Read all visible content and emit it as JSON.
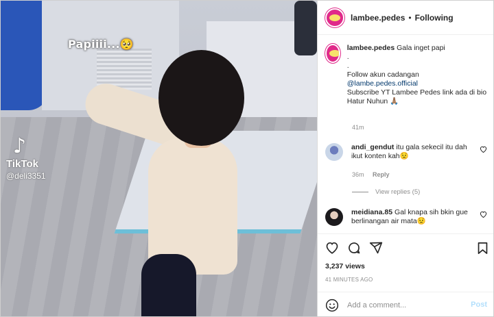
{
  "video": {
    "caption_text": "Papiiii...🥺",
    "watermark_brand": "TikTok",
    "watermark_handle": "@deli3351",
    "logo_glyph": "♪"
  },
  "post": {
    "header": {
      "username": "lambee.pedes",
      "separator": "•",
      "follow_label": "Following"
    },
    "caption": {
      "username": "lambee.pedes",
      "first_line": "Gala inget papi",
      "dot1": ".",
      "dot2": ".",
      "line_follow": "Follow akun cadangan",
      "link": "@lambe.pedes.official",
      "line_subscribe": "Subscribe YT Lambee Pedes link ada di bio Hatur Nuhun 🙏🏽",
      "time": "41m"
    },
    "comments": [
      {
        "username": "andi_gendut",
        "text": "itu gala sekecil itu dah ikut konten kah😟",
        "time": "36m",
        "reply_label": "Reply",
        "view_replies": "View replies (5)"
      },
      {
        "username": "meidiana.85",
        "text": "Gal knapa sih bkin gue berlinangan air mata😟"
      }
    ],
    "views": "3,237 views",
    "posted_ago": "41 MINUTES AGO",
    "add_comment": {
      "placeholder": "Add a comment...",
      "post_label": "Post"
    },
    "icons": {
      "like": "heart-icon",
      "comment": "comment-icon",
      "share": "share-icon",
      "save": "bookmark-icon",
      "emoji": "emoji-icon"
    }
  }
}
